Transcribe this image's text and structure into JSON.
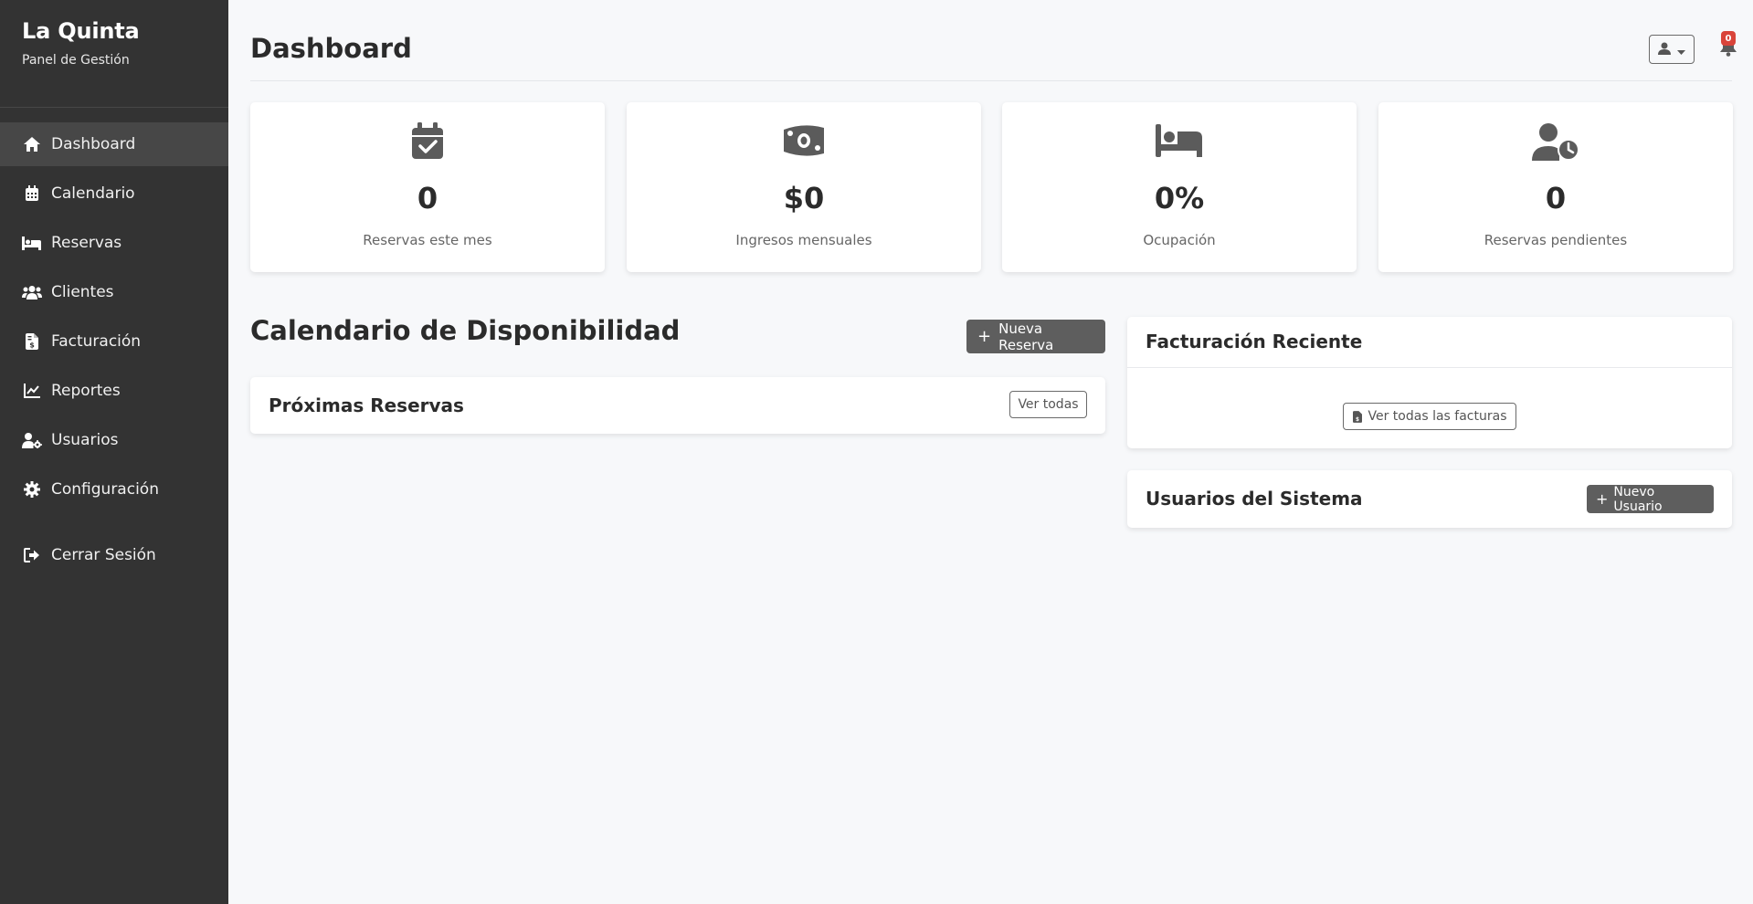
{
  "sidebar": {
    "brand_title": "La Quinta",
    "brand_subtitle": "Panel de Gestión",
    "items": [
      {
        "label": "Dashboard",
        "icon": "home-icon"
      },
      {
        "label": "Calendario",
        "icon": "calendar-icon"
      },
      {
        "label": "Reservas",
        "icon": "bed-icon"
      },
      {
        "label": "Clientes",
        "icon": "users-icon"
      },
      {
        "label": "Facturación",
        "icon": "invoice-icon"
      },
      {
        "label": "Reportes",
        "icon": "chart-line-icon"
      },
      {
        "label": "Usuarios",
        "icon": "user-gear-icon"
      },
      {
        "label": "Configuración",
        "icon": "gear-icon"
      }
    ],
    "logout_label": "Cerrar Sesión"
  },
  "header": {
    "title": "Dashboard",
    "notification_count": "0"
  },
  "stats": [
    {
      "value": "0",
      "label": "Reservas este mes",
      "icon": "calendar-check-icon"
    },
    {
      "value": "$0",
      "label": "Ingresos mensuales",
      "icon": "money-bill-icon"
    },
    {
      "value": "0%",
      "label": "Ocupación",
      "icon": "bed-icon"
    },
    {
      "value": "0",
      "label": "Reservas pendientes",
      "icon": "user-clock-icon"
    }
  ],
  "calendar": {
    "title": "Calendario de Disponibilidad",
    "new_reservation_label": "Nueva Reserva"
  },
  "upcoming": {
    "title": "Próximas Reservas",
    "view_all_label": "Ver todas"
  },
  "billing": {
    "title": "Facturación Reciente",
    "view_all_label": "Ver todas las facturas"
  },
  "system_users": {
    "title": "Usuarios del Sistema",
    "new_user_label": "Nuevo Usuario"
  },
  "colors": {
    "sidebar_bg": "#333333",
    "sidebar_active": "#474747",
    "page_bg": "#f7f8fa",
    "button_dark": "#5e5e5e",
    "badge": "#d9443a",
    "icon_gray": "#5b5b5b"
  }
}
